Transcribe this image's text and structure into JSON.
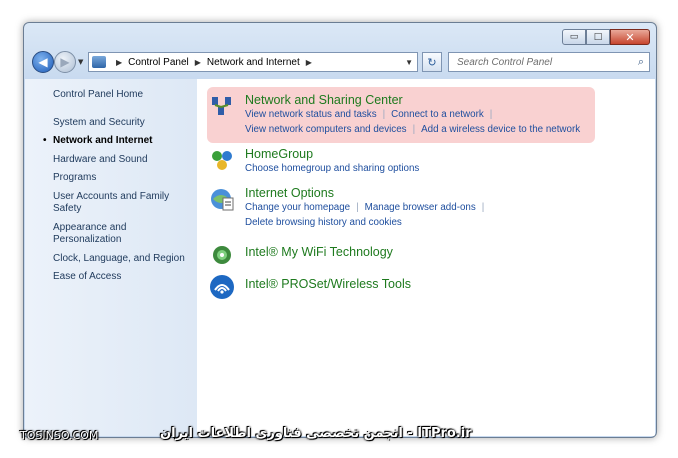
{
  "window": {
    "caption_buttons": {
      "minimize": "▭",
      "maximize": "□",
      "close": "✕"
    }
  },
  "navigation": {
    "back_icon": "back-arrow-icon",
    "forward_icon": "forward-arrow-icon",
    "breadcrumb": [
      "Control Panel",
      "Network and Internet"
    ],
    "search_placeholder": "Search Control Panel"
  },
  "sidebar": {
    "home": "Control Panel Home",
    "items": [
      {
        "label": "System and Security",
        "active": false
      },
      {
        "label": "Network and Internet",
        "active": true
      },
      {
        "label": "Hardware and Sound",
        "active": false
      },
      {
        "label": "Programs",
        "active": false
      },
      {
        "label": "User Accounts and Family Safety",
        "active": false
      },
      {
        "label": "Appearance and Personalization",
        "active": false
      },
      {
        "label": "Clock, Language, and Region",
        "active": false
      },
      {
        "label": "Ease of Access",
        "active": false
      }
    ]
  },
  "categories": [
    {
      "title": "Network and Sharing Center",
      "icon": "network-sharing-icon",
      "links": [
        [
          "View network status and tasks",
          "Connect to a network"
        ],
        [
          "View network computers and devices",
          "Add a wireless device to the network"
        ]
      ]
    },
    {
      "title": "HomeGroup",
      "icon": "homegroup-icon",
      "links": [
        [
          "Choose homegroup and sharing options"
        ]
      ]
    },
    {
      "title": "Internet Options",
      "icon": "internet-options-icon",
      "links": [
        [
          "Change your homepage",
          "Manage browser add-ons"
        ],
        [
          "Delete browsing history and cookies"
        ]
      ]
    },
    {
      "title": "Intel® My WiFi Technology",
      "icon": "intel-wifi-icon",
      "links": []
    },
    {
      "title": "Intel® PROSet/Wireless Tools",
      "icon": "intel-proset-icon",
      "links": []
    }
  ],
  "watermark": {
    "left": "TOSINSO.COM",
    "right": "ITPro.ir - انجمن تخصصی فناوری اطلاعات ایران"
  },
  "colors": {
    "highlight": "#f9cfcf",
    "category_title": "#1e7a1e",
    "link": "#1e4e9e"
  }
}
